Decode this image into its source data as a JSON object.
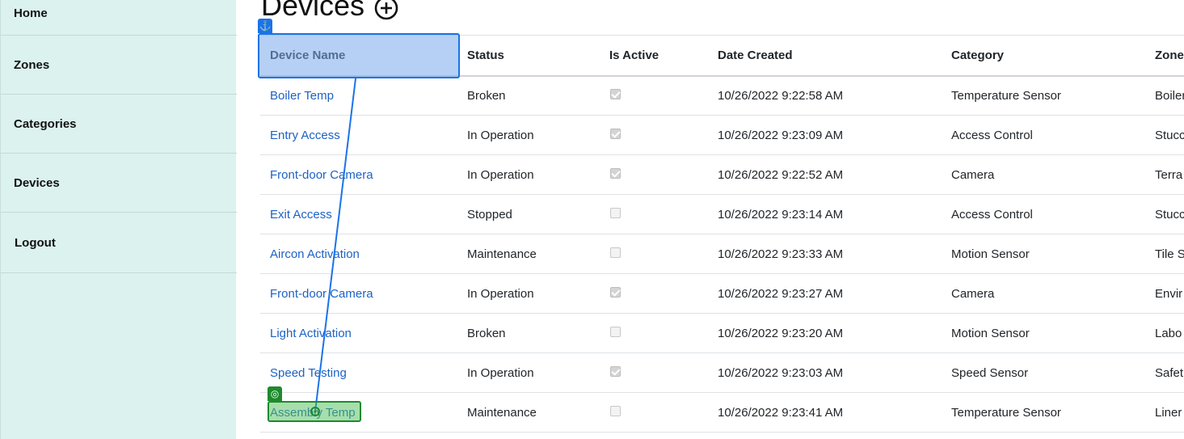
{
  "sidebar": {
    "items": [
      {
        "label": "Home"
      },
      {
        "label": "Zones"
      },
      {
        "label": "Categories"
      },
      {
        "label": "Devices"
      },
      {
        "label": "Logout"
      }
    ]
  },
  "page": {
    "title": "Devices",
    "add_icon": "plus-circle-icon"
  },
  "table": {
    "columns": [
      "Device Name",
      "Status",
      "Is Active",
      "Date Created",
      "Category",
      "Zone"
    ],
    "rows": [
      {
        "name": "Boiler Temp",
        "status": "Broken",
        "active": true,
        "date": "10/26/2022 9:22:58 AM",
        "category": "Temperature Sensor",
        "zone": "Boiler"
      },
      {
        "name": "Entry Access",
        "status": "In Operation",
        "active": true,
        "date": "10/26/2022 9:23:09 AM",
        "category": "Access Control",
        "zone": "Stucco"
      },
      {
        "name": "Front-door Camera",
        "status": "In Operation",
        "active": true,
        "date": "10/26/2022 9:22:52 AM",
        "category": "Camera",
        "zone": "Terra"
      },
      {
        "name": "Exit Access",
        "status": "Stopped",
        "active": false,
        "date": "10/26/2022 9:23:14 AM",
        "category": "Access Control",
        "zone": "Stucco"
      },
      {
        "name": "Aircon Activation",
        "status": "Maintenance",
        "active": false,
        "date": "10/26/2022 9:23:33 AM",
        "category": "Motion Sensor",
        "zone": "Tile S"
      },
      {
        "name": "Front-door Camera",
        "status": "In Operation",
        "active": true,
        "date": "10/26/2022 9:23:27 AM",
        "category": "Camera",
        "zone": "Envir"
      },
      {
        "name": "Light Activation",
        "status": "Broken",
        "active": false,
        "date": "10/26/2022 9:23:20 AM",
        "category": "Motion Sensor",
        "zone": "Labo"
      },
      {
        "name": "Speed Testing",
        "status": "In Operation",
        "active": true,
        "date": "10/26/2022 9:23:03 AM",
        "category": "Speed Sensor",
        "zone": "Safet"
      },
      {
        "name": "Assembly Temp",
        "status": "Maintenance",
        "active": false,
        "date": "10/26/2022 9:23:41 AM",
        "category": "Temperature Sensor",
        "zone": "Liner"
      }
    ]
  },
  "overlay": {
    "anchor_icon": "anchor-icon",
    "target_icon": "target-icon",
    "anchor_color": "#1a73e8",
    "target_color": "#1e8a2e"
  }
}
